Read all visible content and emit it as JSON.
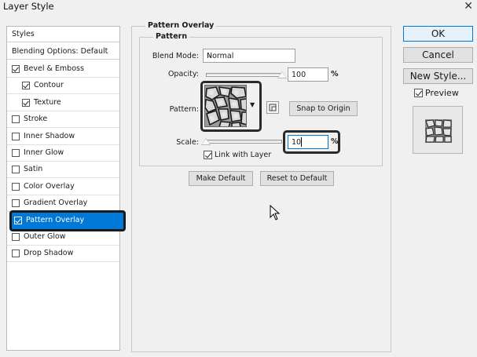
{
  "window": {
    "title": "Layer Style",
    "close_glyph": "✕"
  },
  "styles_panel": {
    "header": "Styles",
    "blending_options": "Blending Options: Default",
    "items": [
      {
        "label": "Bevel & Emboss",
        "checked": true,
        "indent": false
      },
      {
        "label": "Contour",
        "checked": true,
        "indent": true
      },
      {
        "label": "Texture",
        "checked": true,
        "indent": true
      },
      {
        "label": "Stroke",
        "checked": false,
        "indent": false
      },
      {
        "label": "Inner Shadow",
        "checked": false,
        "indent": false
      },
      {
        "label": "Inner Glow",
        "checked": false,
        "indent": false
      },
      {
        "label": "Satin",
        "checked": false,
        "indent": false
      },
      {
        "label": "Color Overlay",
        "checked": false,
        "indent": false
      },
      {
        "label": "Gradient Overlay",
        "checked": false,
        "indent": false
      },
      {
        "label": "Pattern Overlay",
        "checked": true,
        "indent": false,
        "selected": true
      },
      {
        "label": "Outer Glow",
        "checked": false,
        "indent": false
      },
      {
        "label": "Drop Shadow",
        "checked": false,
        "indent": false
      }
    ]
  },
  "pattern_overlay": {
    "group_title": "Pattern Overlay",
    "subgroup_title": "Pattern",
    "blend_mode_label": "Blend Mode:",
    "blend_mode_value": "Normal",
    "opacity_label": "Opacity:",
    "opacity_value": "100",
    "opacity_unit": "%",
    "opacity_fraction": 1.0,
    "pattern_label": "Pattern:",
    "snap_to_origin": "Snap to Origin",
    "scale_label": "Scale:",
    "scale_value": "10",
    "scale_unit": "%",
    "scale_fraction": 0.0,
    "link_with_layer": "Link with Layer",
    "link_checked": true,
    "make_default": "Make Default",
    "reset_to_default": "Reset to Default"
  },
  "right_panel": {
    "ok": "OK",
    "cancel": "Cancel",
    "new_style": "New Style...",
    "preview_label": "Preview",
    "preview_checked": true
  },
  "colors": {
    "selection": "#0078d7",
    "highlight_outline": "#2a2a2a"
  }
}
